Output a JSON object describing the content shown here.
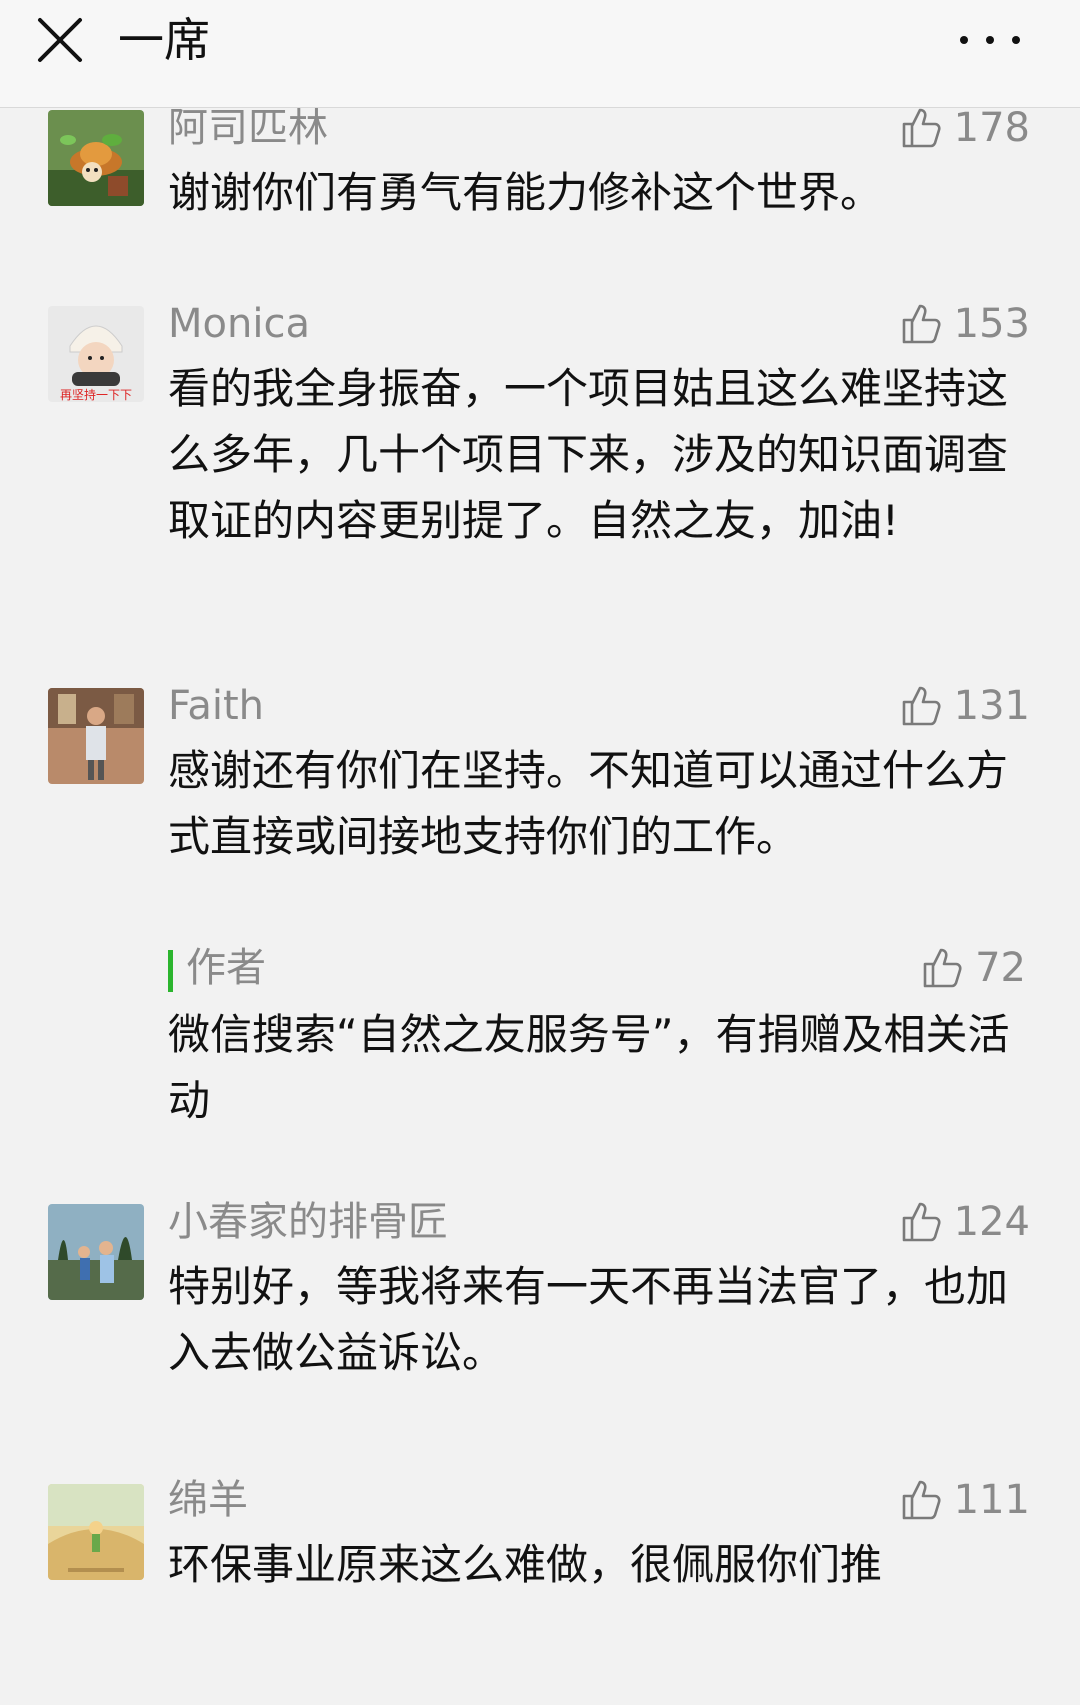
{
  "header": {
    "title": "一席"
  },
  "comments": [
    {
      "nickname": "阿司匹林",
      "likes": "178",
      "content": "谢谢你们有勇气有能力修补这个世界。"
    },
    {
      "nickname": "Monica",
      "likes": "153",
      "content": "看的我全身振奋，一个项目姑且这么难坚持这么多年，几十个项目下来，涉及的知识面调查取证的内容更别提了。自然之友，加油!",
      "avatar_caption": "再坚持一下下"
    },
    {
      "nickname": "Faith",
      "likes": "131",
      "content": "感谢还有你们在坚持。不知道可以通过什么方式直接或间接地支持你们的工作。",
      "reply": {
        "author": "作者",
        "likes": "72",
        "content": "微信搜索“自然之友服务号”，有捐赠及相关活动"
      }
    },
    {
      "nickname": "小春家的排骨匠",
      "likes": "124",
      "content": "特别好，等我将来有一天不再当法官了，也加入去做公益诉讼。"
    },
    {
      "nickname": "绵羊",
      "likes": "111",
      "content": "环保事业原来这么难做，很佩服你们推"
    }
  ],
  "icons": {
    "close": "close-icon",
    "more": "more-icon",
    "like": "thumbs-up-icon"
  },
  "colors": {
    "accent_green": "#2bb52e",
    "meta_gray": "#8a8a8a",
    "background": "#f2f2f2"
  }
}
